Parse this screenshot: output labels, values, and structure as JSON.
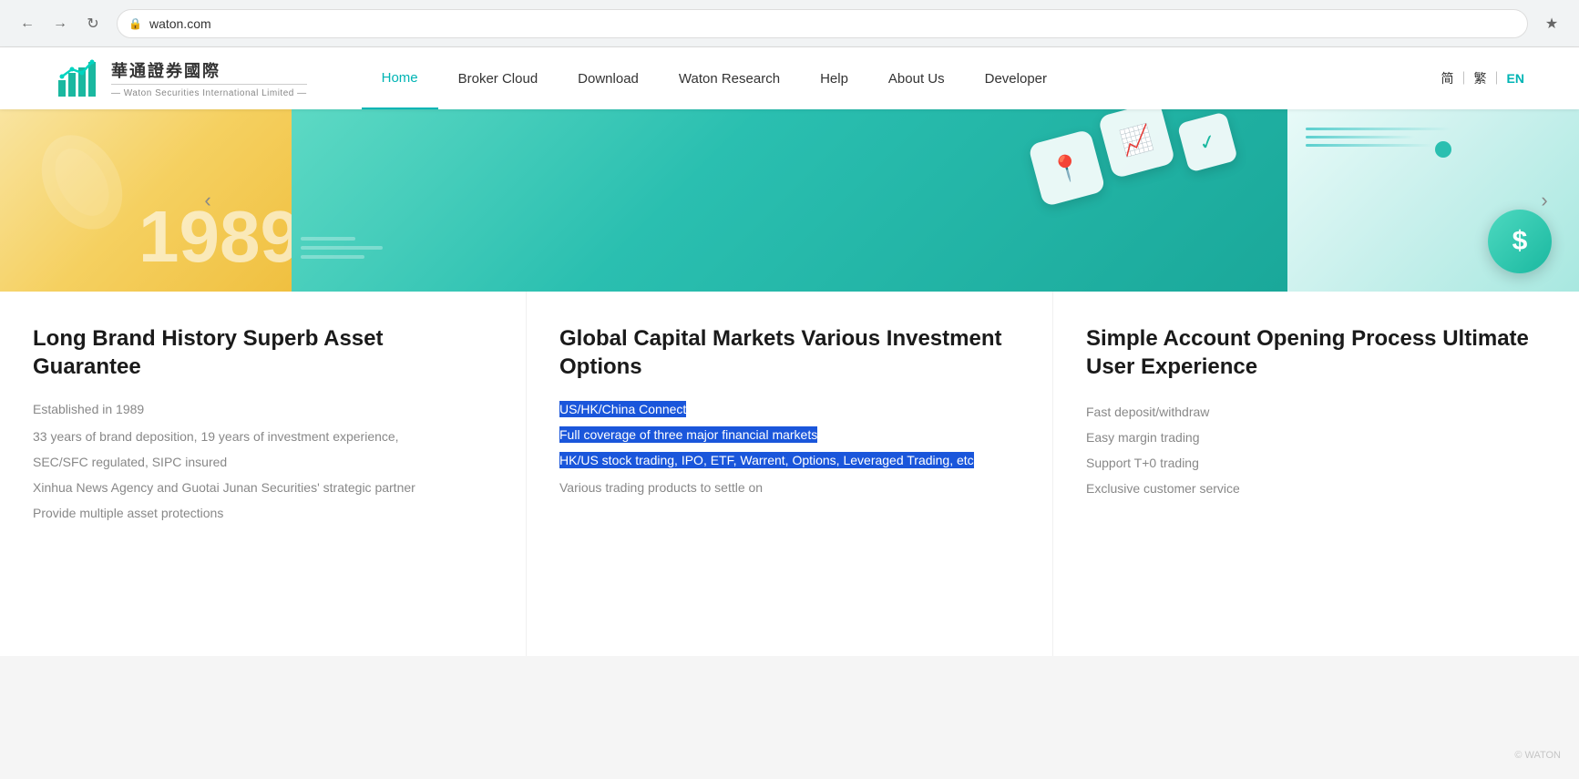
{
  "browser": {
    "url": "waton.com",
    "bookmark_icon": "★"
  },
  "header": {
    "logo_chinese": "華通證券國際",
    "logo_english": "— Waton Securities International Limited —",
    "nav_items": [
      {
        "id": "home",
        "label": "Home",
        "active": true
      },
      {
        "id": "broker-cloud",
        "label": "Broker Cloud",
        "active": false
      },
      {
        "id": "download",
        "label": "Download",
        "active": false
      },
      {
        "id": "waton-research",
        "label": "Waton Research",
        "active": false
      },
      {
        "id": "help",
        "label": "Help",
        "active": false
      },
      {
        "id": "about-us",
        "label": "About Us",
        "active": false
      },
      {
        "id": "developer",
        "label": "Developer",
        "active": false
      }
    ],
    "lang": {
      "simplified": "简",
      "traditional": "繁",
      "english": "EN"
    }
  },
  "carousel": {
    "slide1": {
      "year": "1989"
    },
    "prev_label": "‹",
    "next_label": "›"
  },
  "cards": [
    {
      "id": "brand-history",
      "title": "Long Brand History Superb Asset Guarantee",
      "description_lines": [
        "Established in 1989",
        "33 years of brand deposition, 19 years of investment experience,",
        "SEC/SFC regulated, SIPC insured",
        "Xinhua News Agency and Guotai Junan Securities' strategic partner",
        "Provide multiple asset protections"
      ]
    },
    {
      "id": "global-markets",
      "title": "Global Capital Markets Various Investment Options",
      "highlighted_items": [
        "US/HK/China Connect",
        "Full coverage of three major financial markets",
        "HK/US stock trading, IPO, ETF, Warrent, Options, Leveraged Trading, etc"
      ],
      "plain_text": "Various trading products to settle on"
    },
    {
      "id": "simple-account",
      "title": "Simple Account Opening Process Ultimate User Experience",
      "features": [
        "Fast deposit/withdraw",
        "Easy margin trading",
        "Support T+0 trading",
        "Exclusive customer service"
      ]
    }
  ]
}
